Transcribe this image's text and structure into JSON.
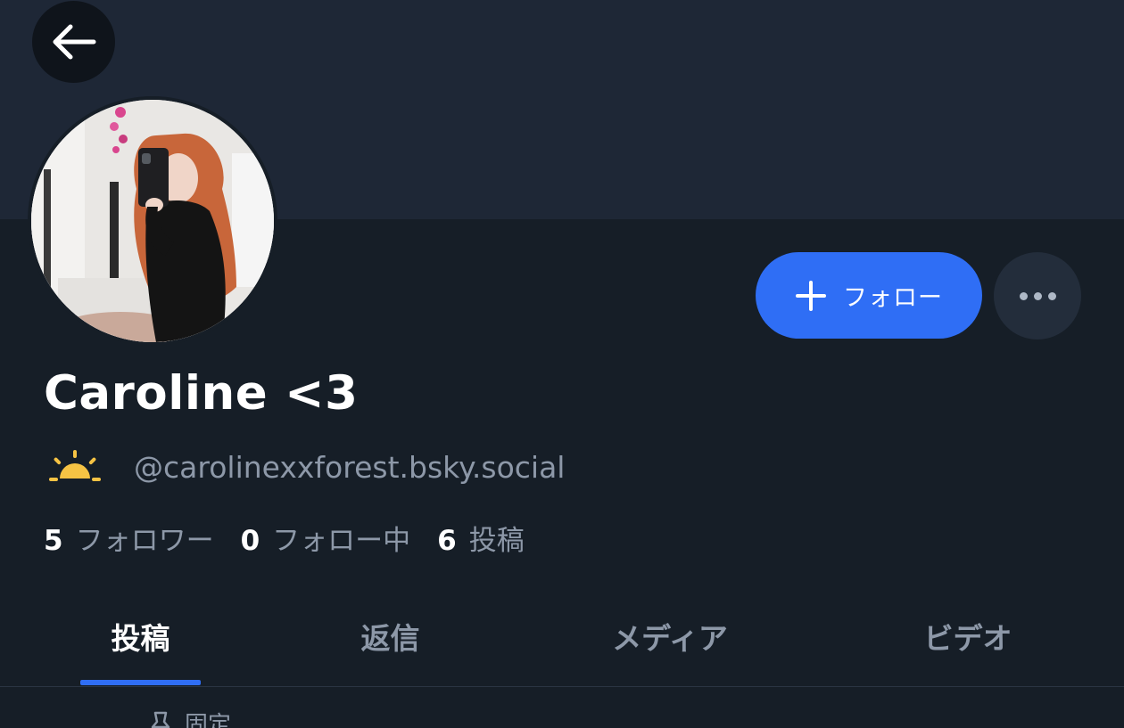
{
  "navigation": {
    "back_icon": "arrow-left-icon"
  },
  "profile": {
    "display_name": "Caroline <3",
    "handle": "@carolinexxforest.bsky.social",
    "handle_icon": "sunrise-icon",
    "avatar_description": "profile photo"
  },
  "actions": {
    "follow_label": "フォロー",
    "follow_icon": "plus-icon",
    "more_icon": "more-horizontal-icon"
  },
  "stats": {
    "followers_count": "5",
    "followers_label": "フォロワー",
    "following_count": "0",
    "following_label": "フォロー中",
    "posts_count": "6",
    "posts_label": "投稿"
  },
  "tabs": [
    {
      "label": "投稿",
      "active": true
    },
    {
      "label": "返信",
      "active": false
    },
    {
      "label": "メディア",
      "active": false
    },
    {
      "label": "ビデオ",
      "active": false
    }
  ],
  "feed": {
    "pinned_label": "固定",
    "pinned_icon": "pin-icon"
  },
  "colors": {
    "background": "#161e27",
    "banner": "#1e2736",
    "accent": "#2f6ef5",
    "muted_text": "#8d98a8",
    "sun_icon": "#f6c344"
  }
}
